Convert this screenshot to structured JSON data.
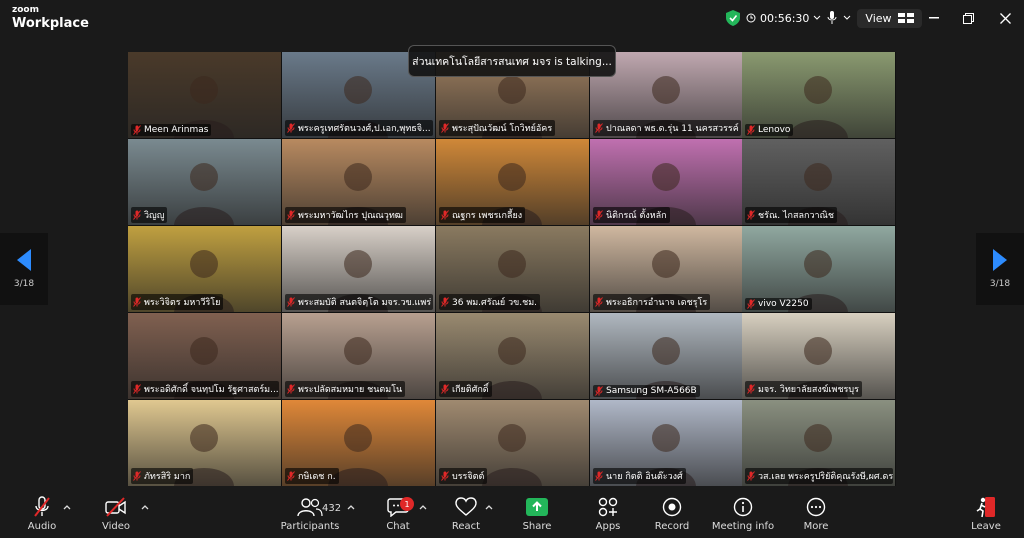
{
  "app": {
    "logo_line1": "zoom",
    "logo_line2": "Workplace"
  },
  "status": {
    "timer": "00:56:30",
    "view_label": "View"
  },
  "talking_banner": "ส่วนเทคโนโลยีสารสนเทศ มจร is talking...",
  "pager": {
    "left_count": "3/18",
    "right_count": "3/18"
  },
  "participants": [
    {
      "name": "Meen Arinmas",
      "bg": "#4a3a2a"
    },
    {
      "name": "พระครูเทศรัตนวงศ์,ป.เอก,พุทธจิ...",
      "bg": "#6a7a8a"
    },
    {
      "name": "พระสุปัณวัฒน์ โกวิทย์อัคร",
      "bg": "#a08060"
    },
    {
      "name": "ปาณลดา พธ.ด.รุ่น 11 นครสวรรค์",
      "bg": "#c0a8b0"
    },
    {
      "name": "Lenovo",
      "bg": "#8a9a70"
    },
    {
      "name": "วิญญู",
      "bg": "#7a8a90"
    },
    {
      "name": "พระมหาวัฒไกร ปุณณวุทฒ",
      "bg": "#b88a60"
    },
    {
      "name": "ณฐกร เพชรเกลี้ยง",
      "bg": "#d08838"
    },
    {
      "name": "นิติกรณ์ ตั้งหลัก",
      "bg": "#c070b0"
    },
    {
      "name": "ชรัณ. ไกสลกวาณิช",
      "bg": "#606060"
    },
    {
      "name": "พระวิจิตร มหาวีริโย",
      "bg": "#c0a040"
    },
    {
      "name": "พระสมบัติ สนตจิตฺโต มจร.วข.แพร่",
      "bg": "#d8d0c8"
    },
    {
      "name": "36 พม.ศรัณย์ วข.ชม.",
      "bg": "#8a7a60"
    },
    {
      "name": "พระอธิการอำนาจ เดชรุโร",
      "bg": "#d0b8a0"
    },
    {
      "name": "vivo V2250",
      "bg": "#90a8a0"
    },
    {
      "name": "พระอดิศักดิ์ จนทฺปโม รัฐศาสตร์ม...",
      "bg": "#806050"
    },
    {
      "name": "พระปลัดสมหมาย ชนตมโน",
      "bg": "#b8a090"
    },
    {
      "name": "เกียติศักดิ์",
      "bg": "#9a8a70"
    },
    {
      "name": "Samsung SM-A566B",
      "bg": "#b0b8c0"
    },
    {
      "name": "มจร. วิทยาลัยสงฆ์เพชรบุร",
      "bg": "#d8d0c0"
    },
    {
      "name": "ภัทรสิริ มาก",
      "bg": "#e0c890"
    },
    {
      "name": "กษิเดช ก.",
      "bg": "#e08838"
    },
    {
      "name": "บรรจิตต์",
      "bg": "#a08a70"
    },
    {
      "name": "นาย กิตติ อินต๊ะวงศ์",
      "bg": "#b0b8c8"
    },
    {
      "name": "วส.เลย พระครูปริยัติคุณรังษี,ผศ.ดร.",
      "bg": "#8a9080"
    }
  ],
  "toolbar": {
    "audio": "Audio",
    "video": "Video",
    "participants": "Participants",
    "participants_count": "432",
    "chat": "Chat",
    "chat_badge": "1",
    "react": "React",
    "share": "Share",
    "apps": "Apps",
    "record": "Record",
    "meeting_info": "Meeting info",
    "more": "More",
    "leave": "Leave"
  },
  "colors": {
    "accent_blue": "#0e72ed",
    "share_green": "#23b65a",
    "danger_red": "#e02828"
  }
}
